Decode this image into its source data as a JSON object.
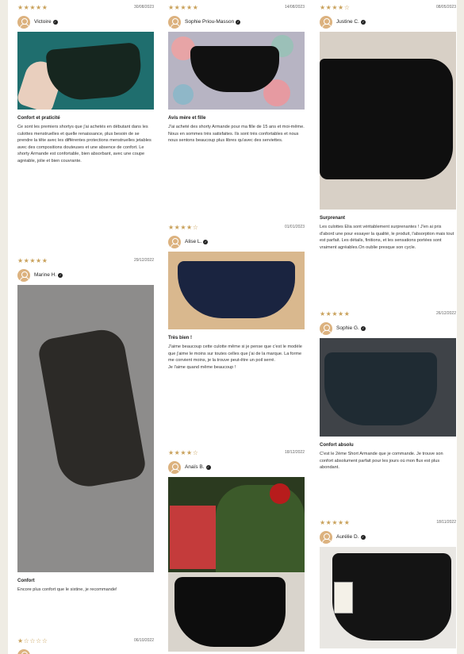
{
  "colors": {
    "background": "#efece4",
    "panel": "#ffffff",
    "star": "#c9a15b",
    "avatar": "#dcb27f",
    "text": "#222222"
  },
  "reviews": [
    {
      "stars": "★★★★★",
      "rating": 5,
      "date": "30/08/2023",
      "author": "Victoire",
      "title": "Confort et praticité",
      "body": "Ce sont les premiers shortys que j'ai achetés en débutant dans les culottes menstruelles et quelle renaissance, plus besoin de se prendre la tête avec les différentes protections menstruelles jetables avec des compositions douteuses et une absence de confort. Le shorty Armande est confortable, bien absorbant, avec une coupe agréable, jolie et bien couvrante."
    },
    {
      "stars": "★★★★★",
      "rating": 5,
      "date": "14/08/2023",
      "author": "Sophie Priou-Masson",
      "title": "Avis mère et fille",
      "body": "J'ai acheté des shorty Armande pour ma fille de 15 ans et moi-même. Nous en sommes très satisfaites. Ils sont très confortables et nous nous sentons beaucoup plus libres qu'avec des serviettes."
    },
    {
      "stars": "★★★★☆",
      "rating": 4,
      "date": "08/05/2023",
      "author": "Justine C.",
      "title": "Surprenant",
      "body": "Les culottes Elia sont véritablement surprenantes ! J'en ai pris d'abord une pour essayer la qualité, le produit, l'absorption mais tout est parfait. Les détails, finitions, et les sensations portées sont vraiment agréables.On oublie presque son cycle."
    },
    {
      "stars": "★★★★★",
      "rating": 5,
      "date": "29/12/2022",
      "author": "Marine H.",
      "title": "Confort",
      "body": "Encore plus confort que le sixtine, je recommande!"
    },
    {
      "stars": "★★★★☆",
      "rating": 4,
      "date": "01/01/2023",
      "author": "Alise L.",
      "title": "Très bien !",
      "body": "J'aime beaucoup cette culotte même si je pense que c'est le modèle que j'aime le moins sur toutes celles que j'ai de la marque. La forme me convient moins, je la trouve peut-être un poil serré.\nJe l'aime quand même beaucoup !"
    },
    {
      "stars": "★★★★★",
      "rating": 5,
      "date": "26/12/2022",
      "author": "Sophie G.",
      "title": "Confort absolu",
      "body": "C'est le 2ème Short Armande que je commande. Je trouve son confort absolument parfait pour les jours où mon flux est plus abondant."
    },
    {
      "stars": "★★★★☆",
      "rating": 4,
      "date": "18/12/2022",
      "author": "Anaïs B."
    },
    {
      "stars": "★★★★★",
      "rating": 5,
      "date": "18/11/2022",
      "author": "Aurélie D."
    },
    {
      "stars": "★☆☆☆☆",
      "rating": 1,
      "date": "06/10/2022"
    }
  ]
}
